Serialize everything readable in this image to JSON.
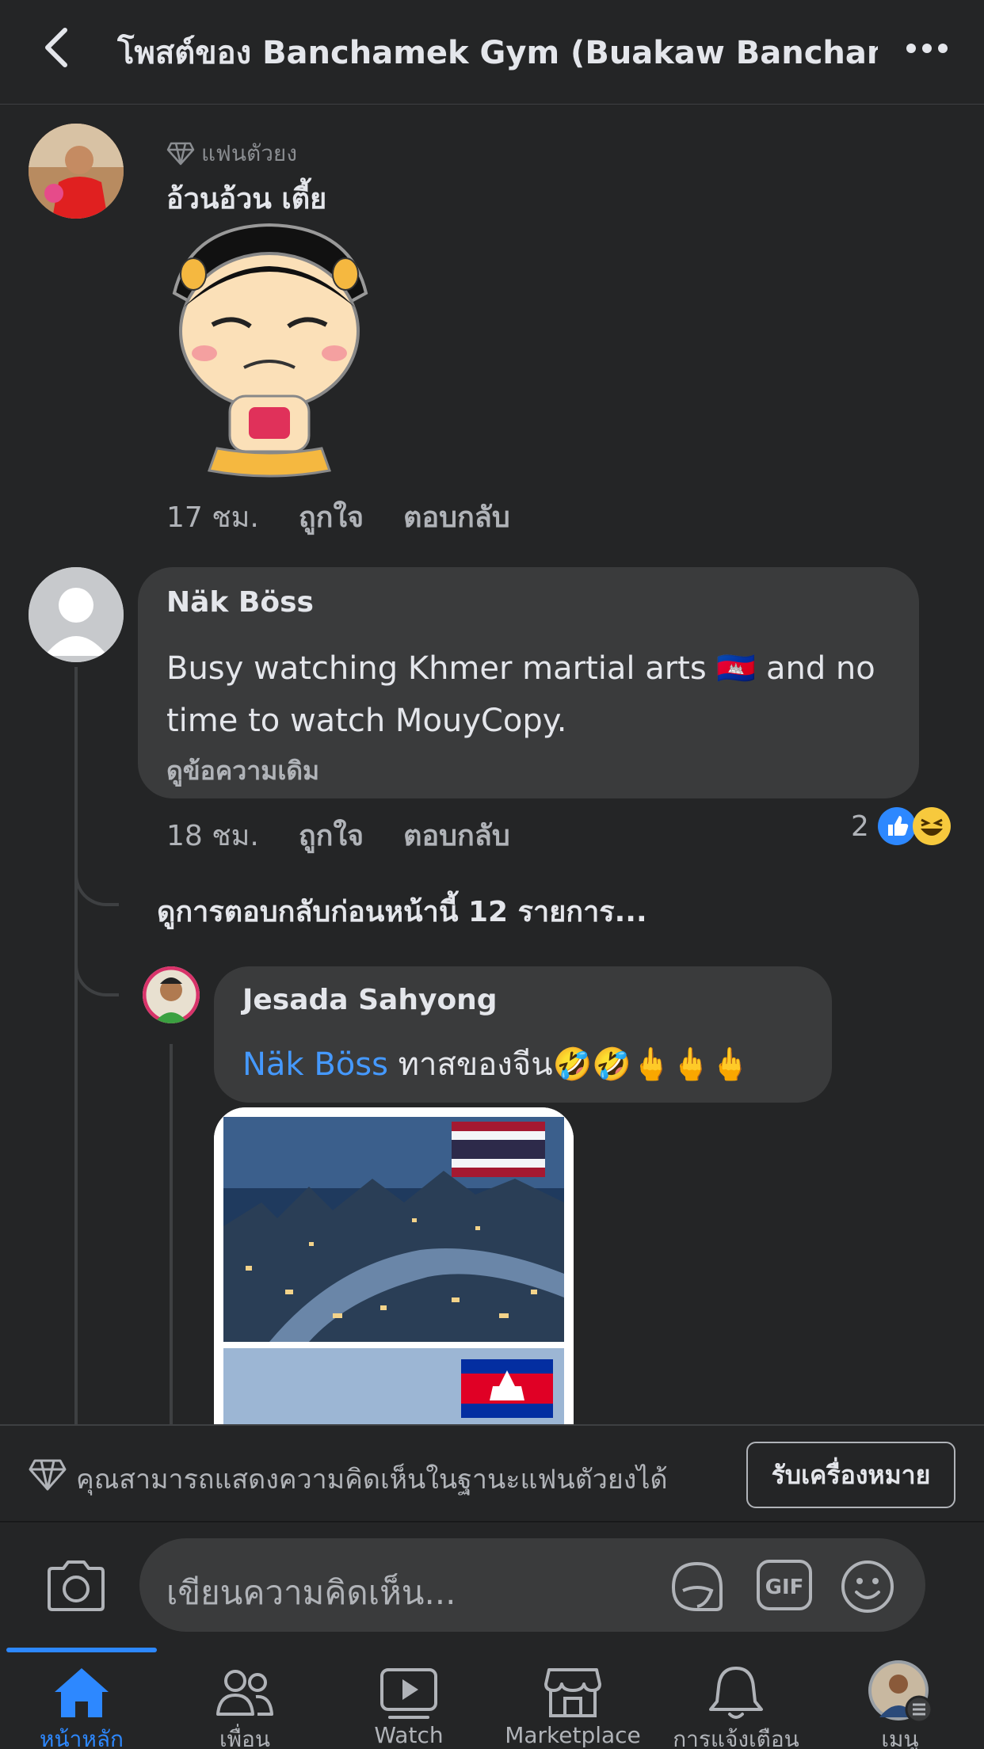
{
  "header": {
    "title": "โพสต์ของ Banchamek Gym (Buakaw Banchame..."
  },
  "comments": [
    {
      "badge": "แฟนตัวยง",
      "author": "อ้วนอ้วน เตี้ย",
      "time": "17 ชม.",
      "like_label": "ถูกใจ",
      "reply_label": "ตอบกลับ"
    },
    {
      "author": "Näk Böss",
      "text_line1": "Busy watching Khmer martial arts",
      "text_flag": "🇰🇭",
      "text_line1b": "and no",
      "text_line2": "time to watch MouyCopy.",
      "see_original": "ดูข้อความเดิม",
      "time": "18 ชม.",
      "like_label": "ถูกใจ",
      "reply_label": "ตอบกลับ",
      "reaction_count": "2"
    }
  ],
  "previous_replies": "ดูการตอบกลับก่อนหน้านี้ 12 รายการ...",
  "reply": {
    "author": "Jesada Sahyong",
    "mention": "Näk Böss",
    "text": " ทาสของจีน🤣🤣🖕🖕🖕"
  },
  "fan_bar": {
    "text": "คุณสามารถแสดงความคิดเห็นในฐานะแฟนตัวยงได้",
    "button": "รับเครื่องหมาย"
  },
  "composer": {
    "placeholder": "เขียนความคิดเห็น...",
    "gif_label": "GIF"
  },
  "tabs": [
    {
      "label": "หน้าหลัก",
      "icon": "home-icon",
      "active": true
    },
    {
      "label": "เพื่อน",
      "icon": "friends-icon"
    },
    {
      "label": "Watch",
      "icon": "watch-icon"
    },
    {
      "label": "Marketplace",
      "icon": "marketplace-icon"
    },
    {
      "label": "การแจ้งเตือน",
      "icon": "bell-icon"
    },
    {
      "label": "เมนู",
      "icon": "menu-avatar-icon"
    }
  ],
  "colors": {
    "background": "#242526",
    "bubble": "#3a3b3c",
    "accent": "#2d88ff",
    "mention": "#4599ff",
    "muted_text": "#b0b3b8"
  }
}
